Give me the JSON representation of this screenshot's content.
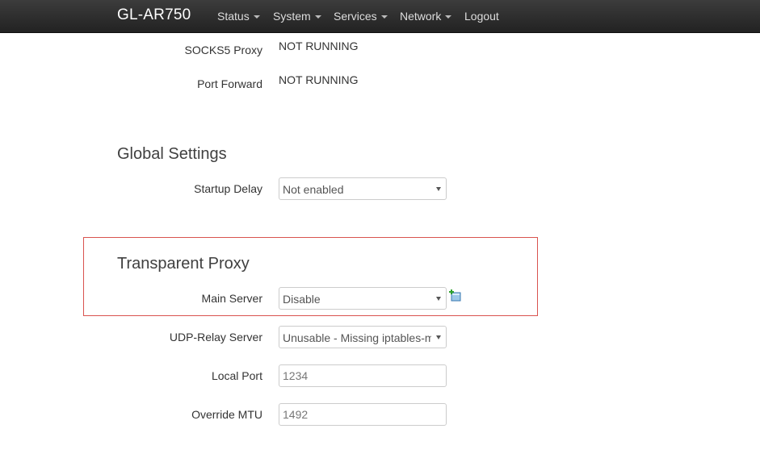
{
  "header": {
    "brand": "GL-AR750",
    "menu": [
      {
        "label": "Status",
        "has_caret": true
      },
      {
        "label": "System",
        "has_caret": true
      },
      {
        "label": "Services",
        "has_caret": true
      },
      {
        "label": "Network",
        "has_caret": true
      },
      {
        "label": "Logout",
        "has_caret": false
      }
    ]
  },
  "status_rows": [
    {
      "label": "SOCKS5 Proxy",
      "value": "NOT RUNNING"
    },
    {
      "label": "Port Forward",
      "value": "NOT RUNNING"
    }
  ],
  "global_settings": {
    "title": "Global Settings",
    "startup_delay": {
      "label": "Startup Delay",
      "value": "Not enabled"
    }
  },
  "transparent_proxy": {
    "title": "Transparent Proxy",
    "main_server": {
      "label": "Main Server",
      "value": "Disable",
      "add_icon": "add-server-icon"
    },
    "udp_relay_server": {
      "label": "UDP-Relay Server",
      "value": "Unusable - Missing iptables-mod-tproxy"
    },
    "local_port": {
      "label": "Local Port",
      "value": "",
      "placeholder": "1234"
    },
    "override_mtu": {
      "label": "Override MTU",
      "value": "",
      "placeholder": "1492"
    }
  },
  "colors": {
    "navbar_top": "#3c3c3c",
    "navbar_bottom": "#222222",
    "highlight_border": "#d9534f"
  }
}
